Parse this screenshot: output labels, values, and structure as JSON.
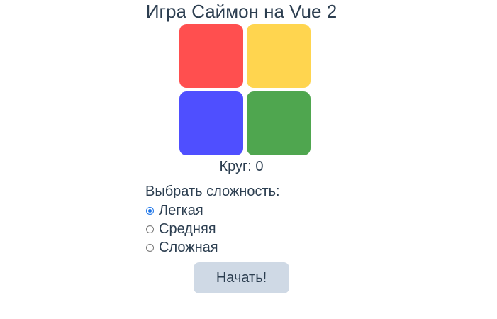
{
  "header": {
    "title": "Игра Саймон на Vue 2"
  },
  "pads": [
    {
      "name": "red",
      "color": "#ff4f4f"
    },
    {
      "name": "yellow",
      "color": "#ffd54f"
    },
    {
      "name": "blue",
      "color": "#4f4fff"
    },
    {
      "name": "green",
      "color": "#4fa64f"
    }
  ],
  "status": {
    "round_text": "Круг: 0"
  },
  "difficulty": {
    "label": "Выбрать сложность:",
    "options": [
      {
        "label": "Легкая",
        "checked": true
      },
      {
        "label": "Средняя",
        "checked": false
      },
      {
        "label": "Сложная",
        "checked": false
      }
    ]
  },
  "actions": {
    "start_label": "Начать!"
  }
}
